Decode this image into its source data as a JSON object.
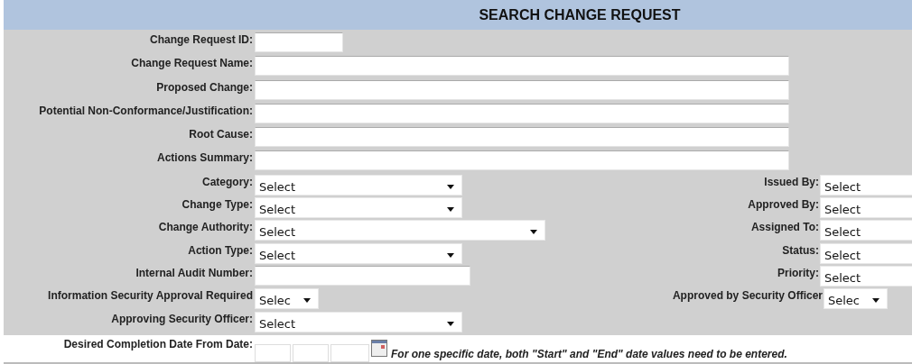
{
  "title": "SEARCH CHANGE REQUEST",
  "text_fields": [
    {
      "label": "Change Request ID:",
      "kind": "short"
    },
    {
      "label": "Change Request Name:",
      "kind": "long"
    },
    {
      "label": "Proposed Change:",
      "kind": "long"
    },
    {
      "label": "Potential Non-Conformance/Justification:",
      "kind": "long"
    },
    {
      "label": "Root Cause:",
      "kind": "long"
    },
    {
      "label": "Actions Summary:",
      "kind": "long"
    }
  ],
  "rows": [
    {
      "left": {
        "label": "Category:",
        "kind": "select",
        "value": "Select"
      },
      "right": {
        "label": "Issued By:",
        "kind": "select",
        "value": "Select"
      }
    },
    {
      "left": {
        "label": "Change Type:",
        "kind": "select",
        "value": "Select"
      },
      "right": {
        "label": "Approved By:",
        "kind": "select",
        "value": "Select"
      }
    },
    {
      "left": {
        "label": "Change Authority:",
        "kind": "wide_select",
        "value": "Select"
      },
      "right": {
        "label": "Assigned To:",
        "kind": "select",
        "value": "Select"
      }
    },
    {
      "left": {
        "label": "Action Type:",
        "kind": "select",
        "value": "Select"
      },
      "right": {
        "label": "Status:",
        "kind": "select",
        "value": "Select"
      }
    },
    {
      "left": {
        "label": "Internal Audit Number:",
        "kind": "text"
      },
      "right": {
        "label": "Priority:",
        "kind": "select",
        "value": "Select"
      }
    },
    {
      "left": {
        "label": "Information Security Approval Required",
        "kind": "small_select",
        "value": "Selec"
      },
      "right": {
        "label": "Approved by Security Officer",
        "kind": "small_select",
        "value": "Selec"
      }
    },
    {
      "left": {
        "label": "Approving Security Officer:",
        "kind": "select",
        "value": "Select"
      }
    }
  ],
  "date": {
    "label": "Desired Completion Date From Date:",
    "note": "For one specific date, both \"Start\" and \"End\" date values need to be entered."
  }
}
